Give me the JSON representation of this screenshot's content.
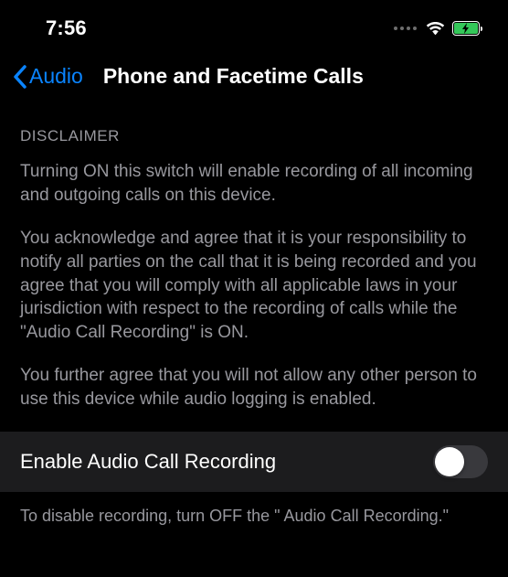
{
  "status": {
    "time": "7:56"
  },
  "nav": {
    "back_label": "Audio",
    "title": "Phone and Facetime Calls"
  },
  "disclaimer": {
    "header": "DISCLAIMER",
    "p1": "Turning ON this switch will enable recording of all incoming and outgoing calls on this device.",
    "p2": "You acknowledge and agree that it is your responsibility to notify all parties on the call that it is being recorded and you agree that you will comply with all applicable laws in your jurisdiction with respect to the recording of calls while the \"Audio Call Recording\" is ON.",
    "p3": "You further agree that you will not allow any other person to use this device while audio logging is enabled."
  },
  "setting": {
    "label": "Enable Audio Call Recording",
    "footer": "To disable recording, turn OFF the \" Audio Call Recording.\""
  }
}
